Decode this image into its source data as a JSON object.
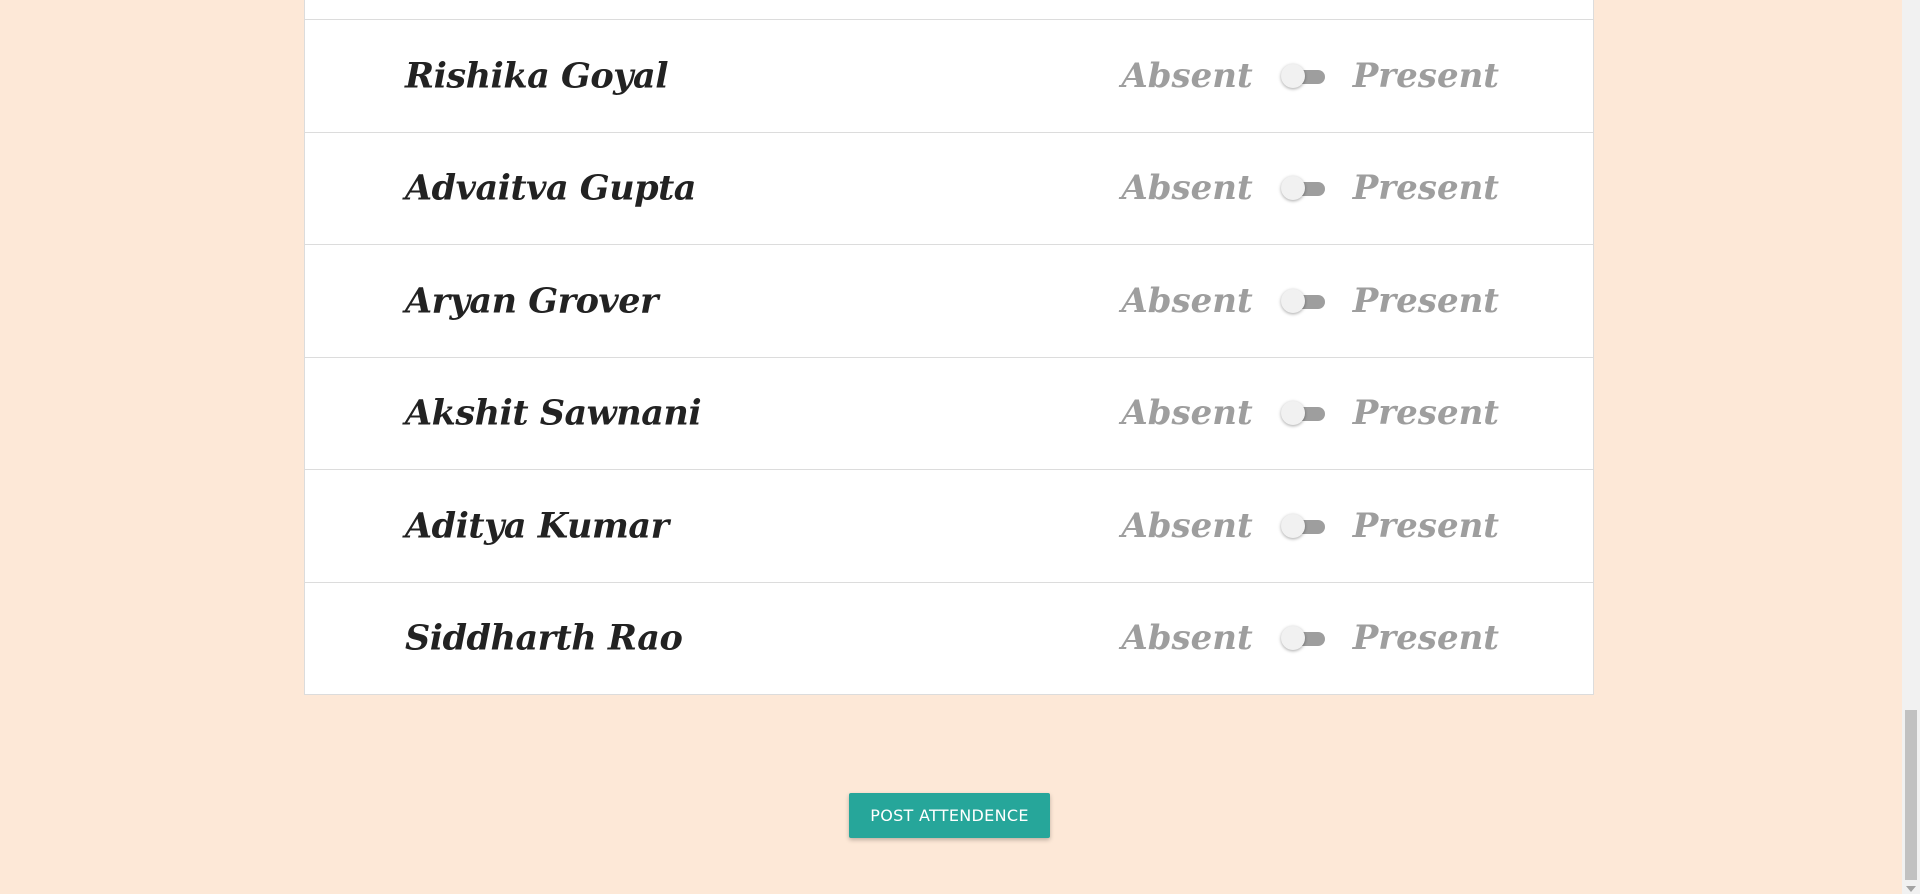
{
  "students": [
    {
      "name": "Rishika Goyal",
      "present": false
    },
    {
      "name": "Advaitva Gupta",
      "present": false
    },
    {
      "name": "Aryan Grover",
      "present": false
    },
    {
      "name": "Akshit Sawnani",
      "present": false
    },
    {
      "name": "Aditya Kumar",
      "present": false
    },
    {
      "name": "Siddharth Rao",
      "present": false
    }
  ],
  "labels": {
    "absent": "Absent",
    "present": "Present"
  },
  "post_button": {
    "label": "POST ATTENDENCE"
  },
  "colors": {
    "background": "#fde8d7",
    "card": "#ffffff",
    "name_text": "#222222",
    "state_text": "#9e9e9e",
    "button": "#26a69a",
    "toggle_track": "#9e9e9e",
    "toggle_thumb": "#f1f1f1"
  },
  "icons": {
    "toggle": "toggle-switch-icon",
    "scroll_down": "chevron-down-icon"
  }
}
